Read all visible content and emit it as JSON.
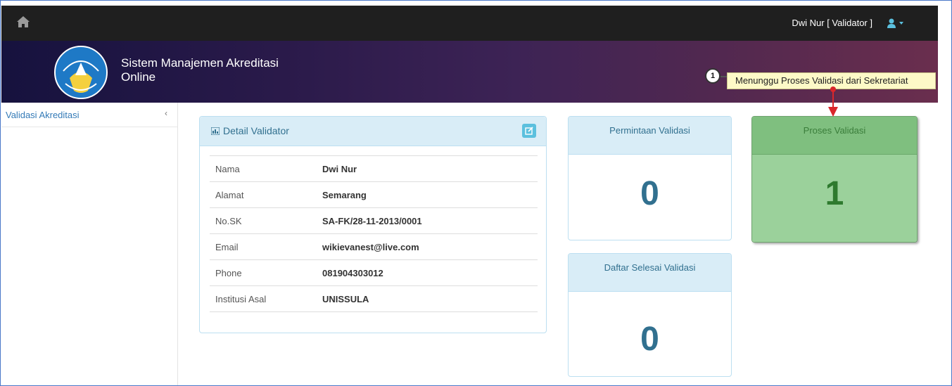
{
  "topbar": {
    "home_icon": "home-icon",
    "user_label": "Dwi Nur [ Validator ]",
    "user_icon": "user-icon"
  },
  "header": {
    "title_line1": "Sistem Manajemen Akreditasi",
    "title_line2": "Online",
    "logo": "tut-wuri-handayani-logo"
  },
  "callout": {
    "number": "1",
    "text": "Menunggu Proses Validasi  dari Sekretariat"
  },
  "sidebar": {
    "items": [
      {
        "label": "Validasi Akreditasi",
        "icon": "chevron-left-icon"
      }
    ]
  },
  "detail_panel": {
    "title": "Detail Validator",
    "rows": [
      {
        "key": "Nama",
        "value": "Dwi Nur"
      },
      {
        "key": "Alamat",
        "value": "Semarang"
      },
      {
        "key": "No.SK",
        "value": "SA-FK/28-11-2013/0001"
      },
      {
        "key": "Email",
        "value": "wikievanest@live.com"
      },
      {
        "key": "Phone",
        "value": "081904303012"
      },
      {
        "key": "Institusi Asal",
        "value": "UNISSULA"
      }
    ]
  },
  "stats": {
    "permintaan": {
      "label": "Permintaan Validasi",
      "value": "0"
    },
    "selesai": {
      "label": "Daftar Selesai Validasi",
      "value": "0"
    },
    "proses": {
      "label": "Proses Validasi",
      "value": "1"
    }
  },
  "colors": {
    "navbar": "#1f1f1f",
    "info_bg": "#d9edf7",
    "info_text": "#31708f",
    "success_box": "#9bd19b",
    "callout_bg": "#fdf9c7",
    "arrow": "#d9262b"
  }
}
